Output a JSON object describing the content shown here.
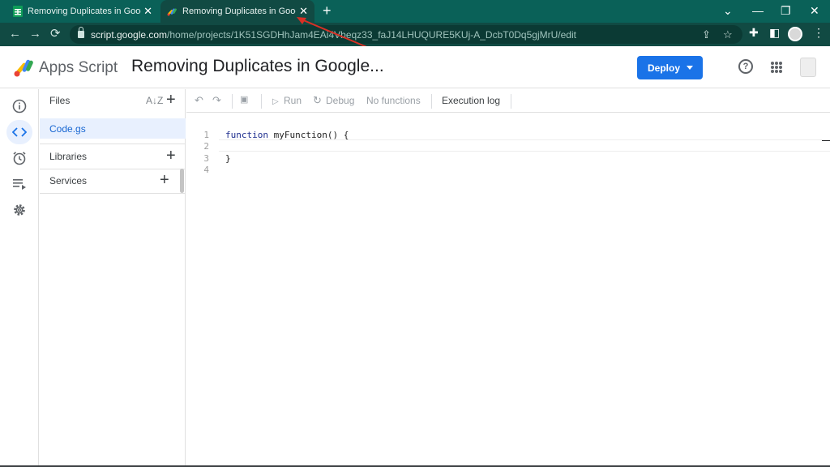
{
  "browser": {
    "tabs": [
      {
        "title": "Removing Duplicates in Google S",
        "icon": "sheets-icon"
      },
      {
        "title": "Removing Duplicates in Google S",
        "icon": "apps-script-icon"
      }
    ],
    "close_glyph": "✕",
    "new_tab_glyph": "+",
    "window_controls": {
      "down": "⌄",
      "minimize": "—",
      "restore": "❐",
      "close": "✕"
    },
    "url_domain": "script.google.com",
    "url_path": "/home/projects/1K51SGDHhJam4EAi4Vbeqz33_faJ14LHUQURE5KUj-A_DcbT0Dq5gjMrU/edit",
    "nav": {
      "back": "←",
      "forward": "→",
      "reload": "⟳"
    }
  },
  "header": {
    "app_name": "Apps Script",
    "project_title": "Removing Duplicates in Google...",
    "deploy_label": "Deploy",
    "help_glyph": "?"
  },
  "files_panel": {
    "files_label": "Files",
    "sort_glyph": "A↓Z",
    "files": [
      {
        "name": "Code.gs"
      }
    ],
    "libraries_label": "Libraries",
    "services_label": "Services",
    "plus_glyph": "+"
  },
  "toolbar": {
    "undo_glyph": "↶",
    "redo_glyph": "↷",
    "save_glyph": "💾",
    "run_glyph": "▷",
    "run_label": "Run",
    "debug_glyph": "↻",
    "debug_label": "Debug",
    "function_select": "No functions",
    "execution_log_label": "Execution log"
  },
  "editor": {
    "lines": [
      {
        "num": "1",
        "keyword": "function",
        "text": " myFunction() {"
      },
      {
        "num": "2",
        "keyword": "",
        "text": ""
      },
      {
        "num": "3",
        "keyword": "",
        "text": "}"
      },
      {
        "num": "4",
        "keyword": "",
        "text": ""
      }
    ]
  },
  "colors": {
    "chrome_frame": "#0a6158",
    "deploy_blue": "#1a73e8",
    "annotation_arrow": "#d93025"
  }
}
